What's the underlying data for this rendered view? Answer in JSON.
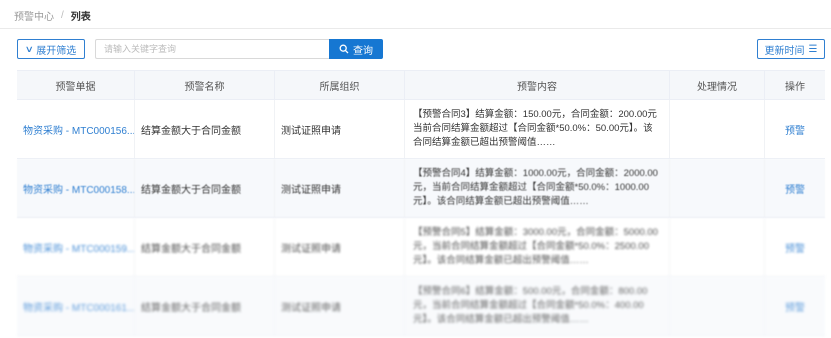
{
  "breadcrumb": {
    "parent": "预警中心",
    "separator": "/",
    "current": "列表"
  },
  "toolbar": {
    "expand_label": "展开筛选",
    "search_placeholder": "请输入关键字查询",
    "search_label": "查询",
    "update_label": "更新时间"
  },
  "table": {
    "headers": [
      "预警单据",
      "预警名称",
      "所属组织",
      "预警内容",
      "处理情况",
      "操作"
    ],
    "rows": [
      {
        "doc": "物资采购 - MTC000156...",
        "name": "结算金额大于合同金额",
        "org": "测试证照申请",
        "content": "【预警合同3】结算金额：150.00元，合同金额：200.00元当前合同结算金额超过【合同金额*50.0%：50.00元】。该合同结算金额已超出预警阈值……",
        "status": "",
        "op": "预警"
      },
      {
        "doc": "物资采购 - MTC000158...",
        "name": "结算金额大于合同金额",
        "org": "测试证照申请",
        "content": "【预警合同4】结算金额：1000.00元，合同金额：2000.00元，当前合同结算金额超过【合同金额*50.0%：1000.00元】。该合同结算金额已超出预警阈值……",
        "status": "",
        "op": "预警"
      },
      {
        "doc": "物资采购 - MTC000159...",
        "name": "结算金额大于合同金额",
        "org": "测试证照申请",
        "content": "【预警合同5】结算金额：3000.00元，合同金额：5000.00元，当前合同结算金额超过【合同金额*50.0%：2500.00元】。该合同结算金额已超出预警阈值……",
        "status": "",
        "op": "预警"
      },
      {
        "doc": "物资采购 - MTC000161...",
        "name": "结算金额大于合同金额",
        "org": "测试证照申请",
        "content": "【预警合同6】结算金额：500.00元，合同金额：800.00元，当前合同结算金额超过【合同金额*50.0%：400.00元】。该合同结算金额已超出预警阈值……",
        "status": "",
        "op": "预警"
      }
    ]
  },
  "colors": {
    "accent": "#1677d2",
    "link": "#2f7fd1",
    "header_bg": "#f5f7fa"
  }
}
